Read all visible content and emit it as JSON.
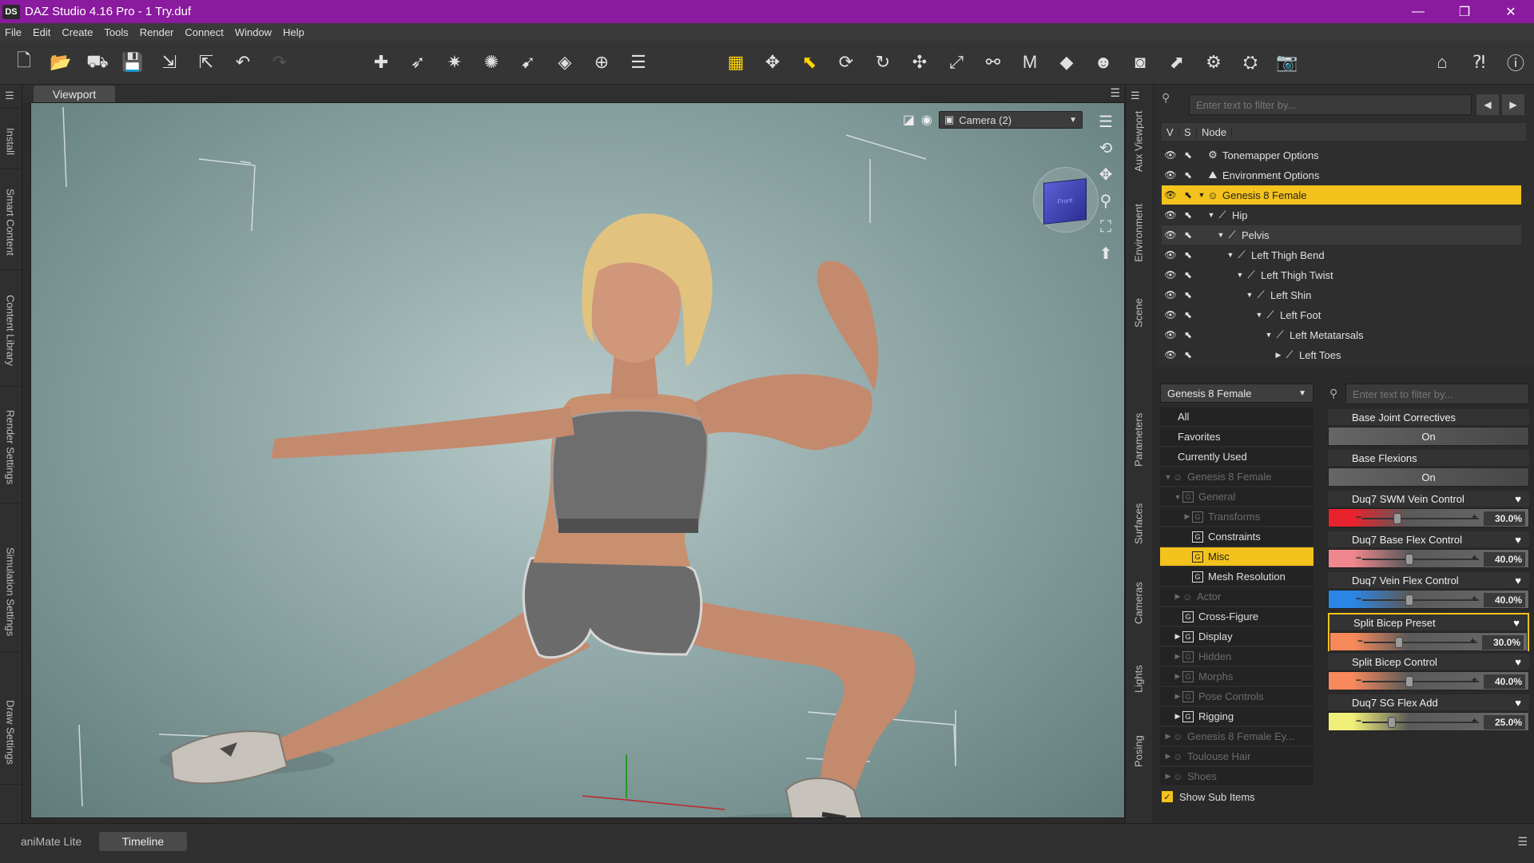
{
  "window": {
    "logo": "DS",
    "title": "DAZ Studio 4.16 Pro - 1 Try.duf",
    "minimize": "—",
    "restore": "❐",
    "close": "✕"
  },
  "menu": [
    "File",
    "Edit",
    "Create",
    "Tools",
    "Render",
    "Connect",
    "Window",
    "Help"
  ],
  "left_tabs": [
    "Install",
    "Smart Content",
    "Content Library",
    "Render Settings",
    "Simulation Settings",
    "Draw Settings"
  ],
  "viewport": {
    "tab": "Viewport",
    "camera": "Camera (2)",
    "cube_label": "Front"
  },
  "right_tabs": [
    "Aux Viewport",
    "Environment",
    "Scene",
    "Parameters",
    "Surfaces",
    "Cameras",
    "Lights",
    "Posing"
  ],
  "scene": {
    "filter_placeholder": "Enter text to filter by...",
    "col_v": "V",
    "col_s": "S",
    "col_node": "Node",
    "nodes": [
      {
        "label": "Tonemapper Options",
        "depth": 0,
        "twist": ""
      },
      {
        "label": "Environment Options",
        "depth": 0,
        "twist": ""
      },
      {
        "label": "Genesis 8 Female",
        "depth": 0,
        "twist": "▼"
      },
      {
        "label": "Hip",
        "depth": 1,
        "twist": "▼"
      },
      {
        "label": "Pelvis",
        "depth": 2,
        "twist": "▼"
      },
      {
        "label": "Left Thigh Bend",
        "depth": 3,
        "twist": "▼"
      },
      {
        "label": "Left Thigh Twist",
        "depth": 4,
        "twist": "▼"
      },
      {
        "label": "Left Shin",
        "depth": 5,
        "twist": "▼"
      },
      {
        "label": "Left Foot",
        "depth": 6,
        "twist": "▼"
      },
      {
        "label": "Left Metatarsals",
        "depth": 7,
        "twist": "▼"
      },
      {
        "label": "Left Toes",
        "depth": 8,
        "twist": "▶"
      }
    ]
  },
  "parameters": {
    "node_select": "Genesis 8 Female",
    "filter_placeholder": "Enter text to filter by...",
    "categories": [
      {
        "label": "All",
        "depth": 0,
        "twist": "",
        "group": false,
        "dim": false
      },
      {
        "label": "Favorites",
        "depth": 0,
        "twist": "",
        "group": false,
        "dim": false
      },
      {
        "label": "Currently Used",
        "depth": 0,
        "twist": "",
        "group": false,
        "dim": false
      },
      {
        "label": "Genesis 8 Female",
        "depth": 0,
        "twist": "▼",
        "group": false,
        "dim": true
      },
      {
        "label": "General",
        "depth": 1,
        "twist": "▼",
        "group": true,
        "dim": true
      },
      {
        "label": "Transforms",
        "depth": 2,
        "twist": "▶",
        "group": true,
        "dim": true
      },
      {
        "label": "Constraints",
        "depth": 2,
        "twist": "",
        "group": true,
        "dim": false
      },
      {
        "label": "Misc",
        "depth": 2,
        "twist": "",
        "group": true,
        "dim": false
      },
      {
        "label": "Mesh Resolution",
        "depth": 2,
        "twist": "",
        "group": true,
        "dim": false
      },
      {
        "label": "Actor",
        "depth": 1,
        "twist": "▶",
        "group": false,
        "dim": true
      },
      {
        "label": "Cross-Figure",
        "depth": 1,
        "twist": "",
        "group": true,
        "dim": false
      },
      {
        "label": "Display",
        "depth": 1,
        "twist": "▶",
        "group": true,
        "dim": false
      },
      {
        "label": "Hidden",
        "depth": 1,
        "twist": "▶",
        "group": true,
        "dim": true
      },
      {
        "label": "Morphs",
        "depth": 1,
        "twist": "▶",
        "group": true,
        "dim": true
      },
      {
        "label": "Pose Controls",
        "depth": 1,
        "twist": "▶",
        "group": true,
        "dim": true
      },
      {
        "label": "Rigging",
        "depth": 1,
        "twist": "▶",
        "group": true,
        "dim": false
      },
      {
        "label": "Genesis 8 Female Ey...",
        "depth": 0,
        "twist": "▶",
        "group": false,
        "dim": true
      },
      {
        "label": "Toulouse Hair",
        "depth": 0,
        "twist": "▶",
        "group": false,
        "dim": true
      },
      {
        "label": "Shoes",
        "depth": 0,
        "twist": "▶",
        "group": false,
        "dim": true
      }
    ],
    "show_sub_items": "Show Sub Items",
    "items": [
      {
        "label": "Base Joint Correctives",
        "kind": "toggle",
        "value": "On"
      },
      {
        "label": "Base Flexions",
        "kind": "toggle",
        "value": "On"
      },
      {
        "label": "Duq7 SWM Vein Control",
        "kind": "slider",
        "value": "30.0%",
        "fraction": 0.3,
        "color": "#e8232d"
      },
      {
        "label": "Duq7 Base Flex Control",
        "kind": "slider",
        "value": "40.0%",
        "fraction": 0.4,
        "color": "#f1878e"
      },
      {
        "label": "Duq7 Vein Flex Control",
        "kind": "slider",
        "value": "40.0%",
        "fraction": 0.4,
        "color": "#2a86e6"
      },
      {
        "label": "Split Bicep Preset",
        "kind": "slider",
        "value": "30.0%",
        "fraction": 0.3,
        "color": "#f7895b"
      },
      {
        "label": "Split Bicep Control",
        "kind": "slider",
        "value": "40.0%",
        "fraction": 0.4,
        "color": "#f7895b"
      },
      {
        "label": "Duq7 SG Flex Add",
        "kind": "slider",
        "value": "25.0%",
        "fraction": 0.25,
        "color": "#f0ef7a"
      }
    ]
  },
  "bottom_tabs": [
    "aniMate Lite",
    "Timeline"
  ]
}
